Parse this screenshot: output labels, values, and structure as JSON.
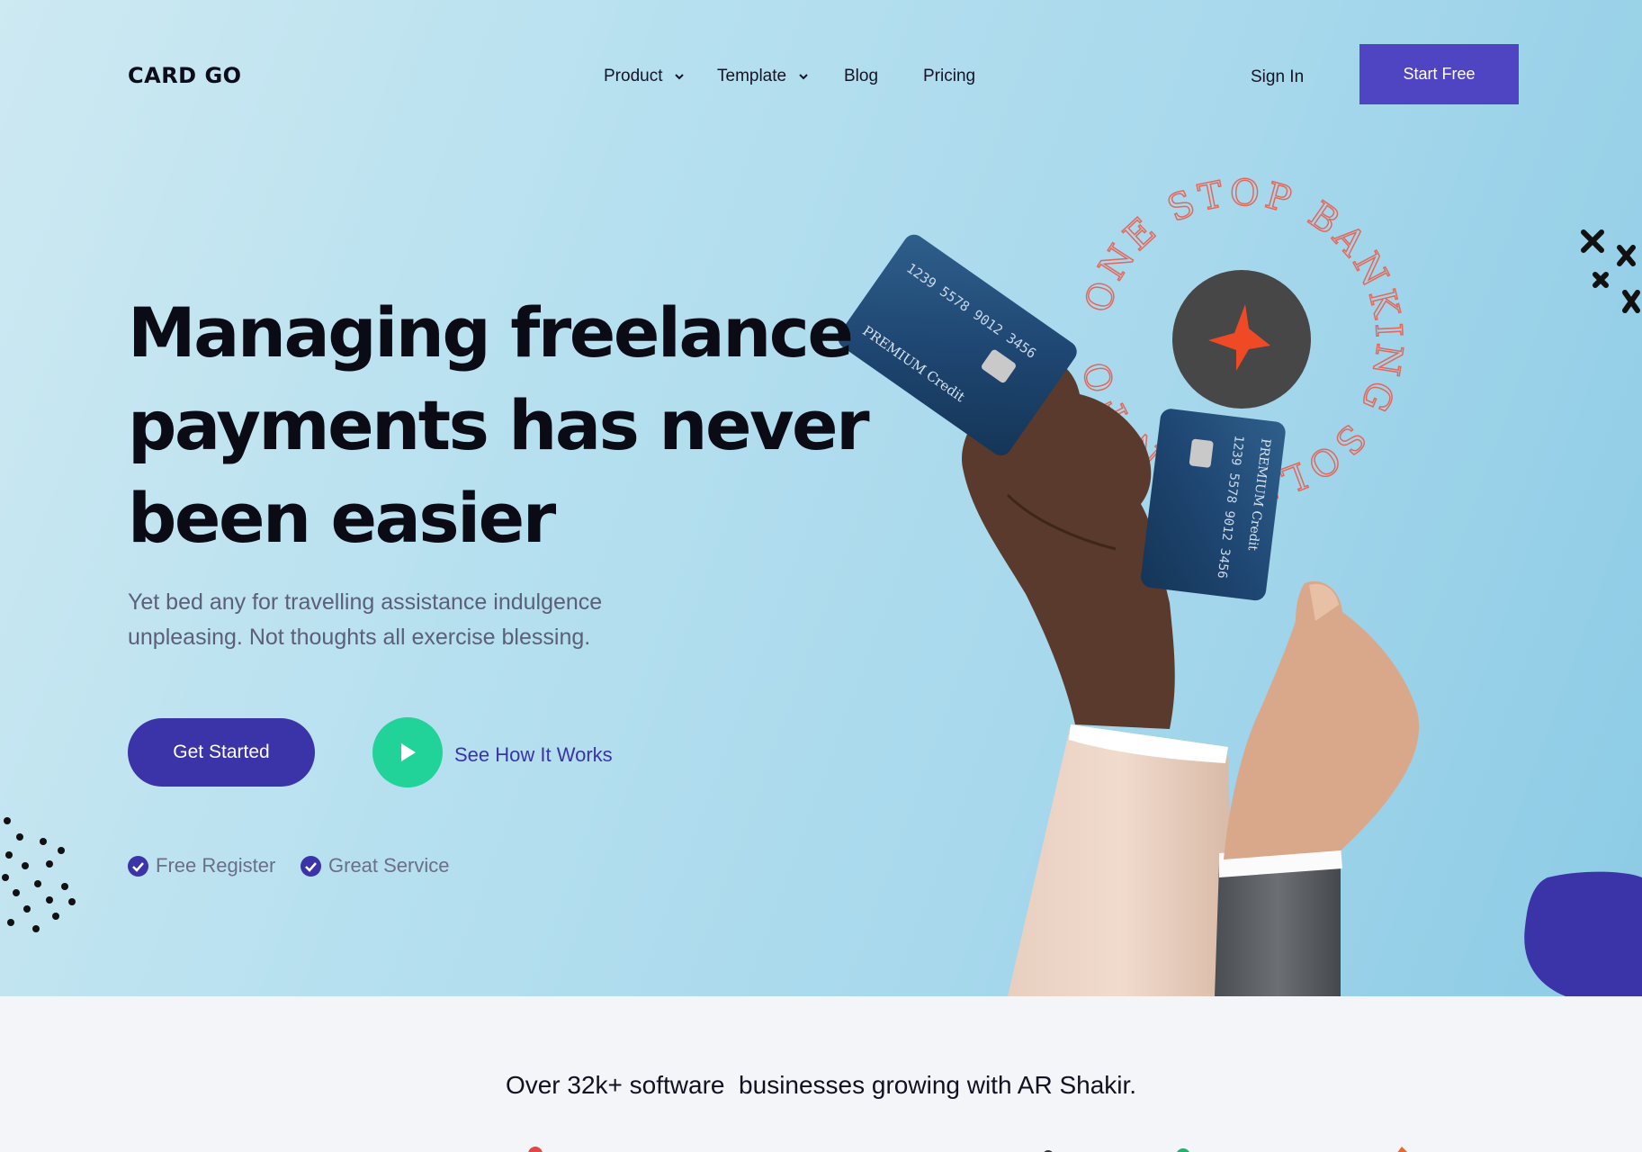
{
  "brand": {
    "logo": "CARD GO"
  },
  "nav": {
    "items": [
      {
        "label": "Product",
        "dropdown": true
      },
      {
        "label": "Template",
        "dropdown": true
      },
      {
        "label": "Blog",
        "dropdown": false
      },
      {
        "label": "Pricing",
        "dropdown": false
      }
    ],
    "sign_in": "Sign In",
    "start_free": "Start Free"
  },
  "hero": {
    "headline_lines": [
      "Managing freelance",
      "payments has never",
      "been easier"
    ],
    "subtitle_lines": [
      "Yet bed any for travelling assistance indulgence",
      "unpleasing. Not thoughts all exercise blessing."
    ],
    "cta_primary": "Get Started",
    "cta_secondary": "See How It Works",
    "checks": [
      "Free Register",
      "Great Service"
    ],
    "badge_text": "ONE STOP BANKING SOLUTION FOR",
    "card_label": "PREMIUM Credit"
  },
  "trust": {
    "text": "Over 32k+ software  businesses growing with AR Shakir."
  },
  "colors": {
    "accent": "#4f44c2",
    "cta": "#3b33a8",
    "play": "#22d399",
    "badge_text": "#e4675a",
    "badge_center": "#484848",
    "star": "#ef4a25"
  }
}
